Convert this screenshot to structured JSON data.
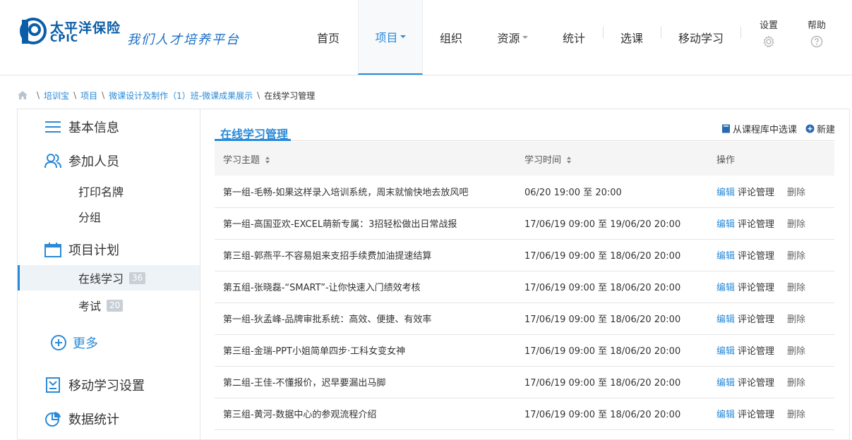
{
  "header": {
    "logo_cn": "太平洋保险",
    "logo_en": "CPIC",
    "slogan": "我们人才培养平台",
    "nav": [
      {
        "label": "首页"
      },
      {
        "label": "项目"
      },
      {
        "label": "组织"
      },
      {
        "label": "资源"
      },
      {
        "label": "统计"
      },
      {
        "label": "选课"
      },
      {
        "label": "移动学习"
      }
    ],
    "settings_label": "设置",
    "help_label": "帮助",
    "accent": "#2a8ad8"
  },
  "breadcrumb": {
    "items": [
      "培训宝",
      "项目",
      "微课设计及制作（1）班-微课成果展示"
    ],
    "current": "在线学习管理"
  },
  "sidebar": {
    "basic_info": "基本信息",
    "participants": "参加人员",
    "print_badge": "打印名牌",
    "grouping": "分组",
    "project_plan": "项目计划",
    "online_learning": "在线学习",
    "online_learning_count": "36",
    "exam": "考试",
    "exam_count": "20",
    "more": "更多",
    "mobile_settings": "移动学习设置",
    "data_stats": "数据统计"
  },
  "main": {
    "title": "在线学习管理",
    "select_from_library": "从课程库中选课",
    "new_label": "新建",
    "columns": [
      "学习主题",
      "学习时间",
      "操作"
    ],
    "op_edit": "编辑",
    "op_comment": "评论管理",
    "op_delete": "删除",
    "rows": [
      {
        "topic": "第一组-毛畅-如果这样录入培训系统，周末就愉快地去放风吧",
        "time": "06/20 19:00 至 20:00"
      },
      {
        "topic": "第一组-高国亚欢-EXCEL萌新专属：3招轻松做出日常战报",
        "time": "17/06/19 09:00 至 19/06/20 20:00"
      },
      {
        "topic": "第三组-郭燕平-不容易姐来支招手续费加油提速结算",
        "time": "17/06/19 09:00 至 18/06/20 20:00"
      },
      {
        "topic": "第五组-张晓磊-“SMART”-让你快速入门绩效考核",
        "time": "17/06/19 09:00 至 18/06/20 20:00"
      },
      {
        "topic": "第一组-狄孟峰-品牌审批系统：高效、便捷、有效率",
        "time": "17/06/19 09:00 至 18/06/20 20:00"
      },
      {
        "topic": "第三组-金瑞-PPT小姐简单四步·工科女变女神",
        "time": "17/06/19 09:00 至 18/06/20 20:00"
      },
      {
        "topic": "第二组-王佳-不懂报价，迟早要漏出马脚",
        "time": "17/06/19 09:00 至 18/06/20 20:00"
      },
      {
        "topic": "第三组-黄河-数据中心的参观流程介绍",
        "time": "17/06/19 09:00 至 18/06/20 20:00"
      }
    ]
  }
}
